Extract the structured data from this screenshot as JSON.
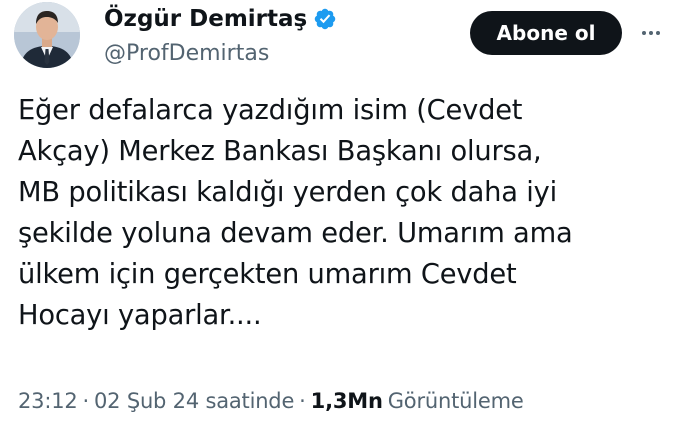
{
  "author": {
    "display_name": "Özgür Demirtaş",
    "handle": "@ProfDemirtas",
    "verified": true,
    "verified_badge_color": "#1d9bf0"
  },
  "follow_button": {
    "label": "Abone ol"
  },
  "more_icon": "more-horizontal-icon",
  "tweet": {
    "text": "Eğer defalarca yazdığım isim (Cevdet\nAkçay) Merkez Bankası Başkanı olursa,\nMB politikası kaldığı yerden çok daha iyi\nşekilde yoluna devam eder. Umarım ama\nülkem için gerçekten umarım Cevdet\nHocayı yaparlar...."
  },
  "meta": {
    "time": "23:12",
    "separator": "·",
    "date": "02 Şub 24 saatinde",
    "views_count": "1,3Mn",
    "views_label": "Görüntüleme"
  },
  "colors": {
    "text_primary": "#0f1419",
    "text_secondary": "#536471",
    "button_bg": "#0f1419",
    "button_text": "#ffffff"
  }
}
